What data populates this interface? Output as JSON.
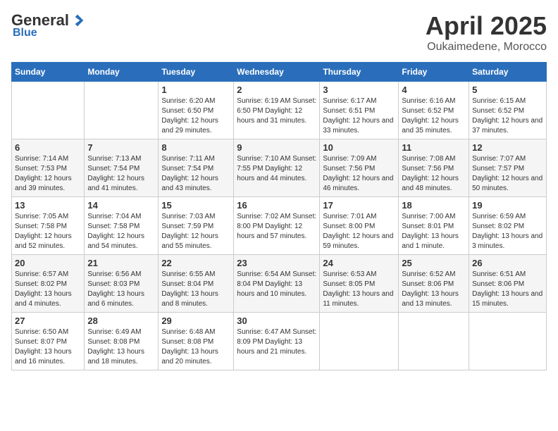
{
  "logo": {
    "general": "General",
    "blue": "Blue"
  },
  "title": "April 2025",
  "location": "Oukaimedene, Morocco",
  "days_of_week": [
    "Sunday",
    "Monday",
    "Tuesday",
    "Wednesday",
    "Thursday",
    "Friday",
    "Saturday"
  ],
  "weeks": [
    [
      {
        "day": "",
        "info": ""
      },
      {
        "day": "",
        "info": ""
      },
      {
        "day": "1",
        "info": "Sunrise: 6:20 AM\nSunset: 6:50 PM\nDaylight: 12 hours\nand 29 minutes."
      },
      {
        "day": "2",
        "info": "Sunrise: 6:19 AM\nSunset: 6:50 PM\nDaylight: 12 hours\nand 31 minutes."
      },
      {
        "day": "3",
        "info": "Sunrise: 6:17 AM\nSunset: 6:51 PM\nDaylight: 12 hours\nand 33 minutes."
      },
      {
        "day": "4",
        "info": "Sunrise: 6:16 AM\nSunset: 6:52 PM\nDaylight: 12 hours\nand 35 minutes."
      },
      {
        "day": "5",
        "info": "Sunrise: 6:15 AM\nSunset: 6:52 PM\nDaylight: 12 hours\nand 37 minutes."
      }
    ],
    [
      {
        "day": "6",
        "info": "Sunrise: 7:14 AM\nSunset: 7:53 PM\nDaylight: 12 hours\nand 39 minutes."
      },
      {
        "day": "7",
        "info": "Sunrise: 7:13 AM\nSunset: 7:54 PM\nDaylight: 12 hours\nand 41 minutes."
      },
      {
        "day": "8",
        "info": "Sunrise: 7:11 AM\nSunset: 7:54 PM\nDaylight: 12 hours\nand 43 minutes."
      },
      {
        "day": "9",
        "info": "Sunrise: 7:10 AM\nSunset: 7:55 PM\nDaylight: 12 hours\nand 44 minutes."
      },
      {
        "day": "10",
        "info": "Sunrise: 7:09 AM\nSunset: 7:56 PM\nDaylight: 12 hours\nand 46 minutes."
      },
      {
        "day": "11",
        "info": "Sunrise: 7:08 AM\nSunset: 7:56 PM\nDaylight: 12 hours\nand 48 minutes."
      },
      {
        "day": "12",
        "info": "Sunrise: 7:07 AM\nSunset: 7:57 PM\nDaylight: 12 hours\nand 50 minutes."
      }
    ],
    [
      {
        "day": "13",
        "info": "Sunrise: 7:05 AM\nSunset: 7:58 PM\nDaylight: 12 hours\nand 52 minutes."
      },
      {
        "day": "14",
        "info": "Sunrise: 7:04 AM\nSunset: 7:58 PM\nDaylight: 12 hours\nand 54 minutes."
      },
      {
        "day": "15",
        "info": "Sunrise: 7:03 AM\nSunset: 7:59 PM\nDaylight: 12 hours\nand 55 minutes."
      },
      {
        "day": "16",
        "info": "Sunrise: 7:02 AM\nSunset: 8:00 PM\nDaylight: 12 hours\nand 57 minutes."
      },
      {
        "day": "17",
        "info": "Sunrise: 7:01 AM\nSunset: 8:00 PM\nDaylight: 12 hours\nand 59 minutes."
      },
      {
        "day": "18",
        "info": "Sunrise: 7:00 AM\nSunset: 8:01 PM\nDaylight: 13 hours\nand 1 minute."
      },
      {
        "day": "19",
        "info": "Sunrise: 6:59 AM\nSunset: 8:02 PM\nDaylight: 13 hours\nand 3 minutes."
      }
    ],
    [
      {
        "day": "20",
        "info": "Sunrise: 6:57 AM\nSunset: 8:02 PM\nDaylight: 13 hours\nand 4 minutes."
      },
      {
        "day": "21",
        "info": "Sunrise: 6:56 AM\nSunset: 8:03 PM\nDaylight: 13 hours\nand 6 minutes."
      },
      {
        "day": "22",
        "info": "Sunrise: 6:55 AM\nSunset: 8:04 PM\nDaylight: 13 hours\nand 8 minutes."
      },
      {
        "day": "23",
        "info": "Sunrise: 6:54 AM\nSunset: 8:04 PM\nDaylight: 13 hours\nand 10 minutes."
      },
      {
        "day": "24",
        "info": "Sunrise: 6:53 AM\nSunset: 8:05 PM\nDaylight: 13 hours\nand 11 minutes."
      },
      {
        "day": "25",
        "info": "Sunrise: 6:52 AM\nSunset: 8:06 PM\nDaylight: 13 hours\nand 13 minutes."
      },
      {
        "day": "26",
        "info": "Sunrise: 6:51 AM\nSunset: 8:06 PM\nDaylight: 13 hours\nand 15 minutes."
      }
    ],
    [
      {
        "day": "27",
        "info": "Sunrise: 6:50 AM\nSunset: 8:07 PM\nDaylight: 13 hours\nand 16 minutes."
      },
      {
        "day": "28",
        "info": "Sunrise: 6:49 AM\nSunset: 8:08 PM\nDaylight: 13 hours\nand 18 minutes."
      },
      {
        "day": "29",
        "info": "Sunrise: 6:48 AM\nSunset: 8:08 PM\nDaylight: 13 hours\nand 20 minutes."
      },
      {
        "day": "30",
        "info": "Sunrise: 6:47 AM\nSunset: 8:09 PM\nDaylight: 13 hours\nand 21 minutes."
      },
      {
        "day": "",
        "info": ""
      },
      {
        "day": "",
        "info": ""
      },
      {
        "day": "",
        "info": ""
      }
    ]
  ]
}
